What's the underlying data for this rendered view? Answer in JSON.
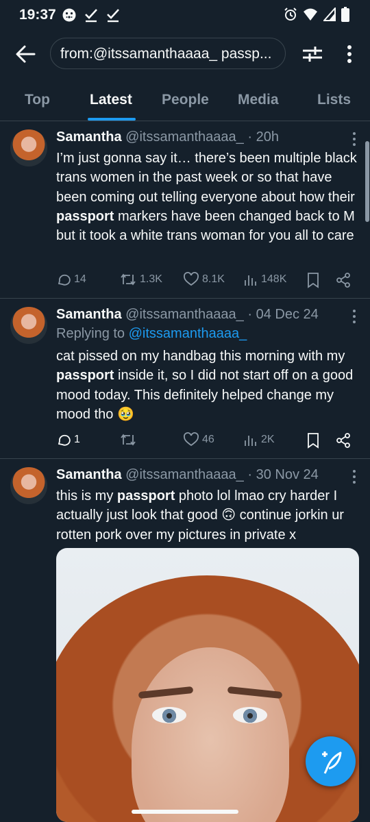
{
  "status_bar": {
    "time": "19:37"
  },
  "search": {
    "query": "from:@itssamanthaaaa_ passp..."
  },
  "tabs": [
    {
      "label": "Top",
      "active": false
    },
    {
      "label": "Latest",
      "active": true
    },
    {
      "label": "People",
      "active": false
    },
    {
      "label": "Media",
      "active": false
    },
    {
      "label": "Lists",
      "active": false
    }
  ],
  "tweets": [
    {
      "name": "Samantha",
      "handle": "@itssamanthaaaa_",
      "time": "· 20h",
      "text_before": "I’m just gonna say it… there’s been multiple black trans women in the past week or so that have been coming out telling everyone about how their ",
      "highlight": "passport",
      "text_after": " markers have been changed back to M but it took a white trans woman for you all to care",
      "replies": "14",
      "retweets": "1.3K",
      "likes": "8.1K",
      "views": "148K"
    },
    {
      "name": "Samantha",
      "handle": "@itssamanthaaaa_",
      "time": "· 04 Dec 24",
      "replying_prefix": "Replying to",
      "replying_to": "@itssamanthaaaa_",
      "text_before": "cat pissed on my handbag this morning with my ",
      "highlight": "passport",
      "text_after": " inside it, so I did not start off on a good mood today. This definitely helped change my mood tho 🥹",
      "replies": "1",
      "retweets": "",
      "likes": "46",
      "views": "2K"
    },
    {
      "name": "Samantha",
      "handle": "@itssamanthaaaa_",
      "time": "· 30 Nov 24",
      "text_before": "this is my ",
      "highlight": "passport",
      "text_after": " photo lol lmao cry harder I actually just look that good 🙃 continue jorkin ur rotten pork over my pictures in private x"
    }
  ],
  "colors": {
    "background": "#15202b",
    "accent": "#1d9bf0",
    "muted": "#8b98a5",
    "divider": "#38444d"
  },
  "icons": [
    "back-arrow-icon",
    "filter-icon",
    "more-vertical-icon",
    "reply-icon",
    "retweet-icon",
    "like-icon",
    "views-icon",
    "bookmark-icon",
    "share-icon",
    "compose-icon"
  ]
}
